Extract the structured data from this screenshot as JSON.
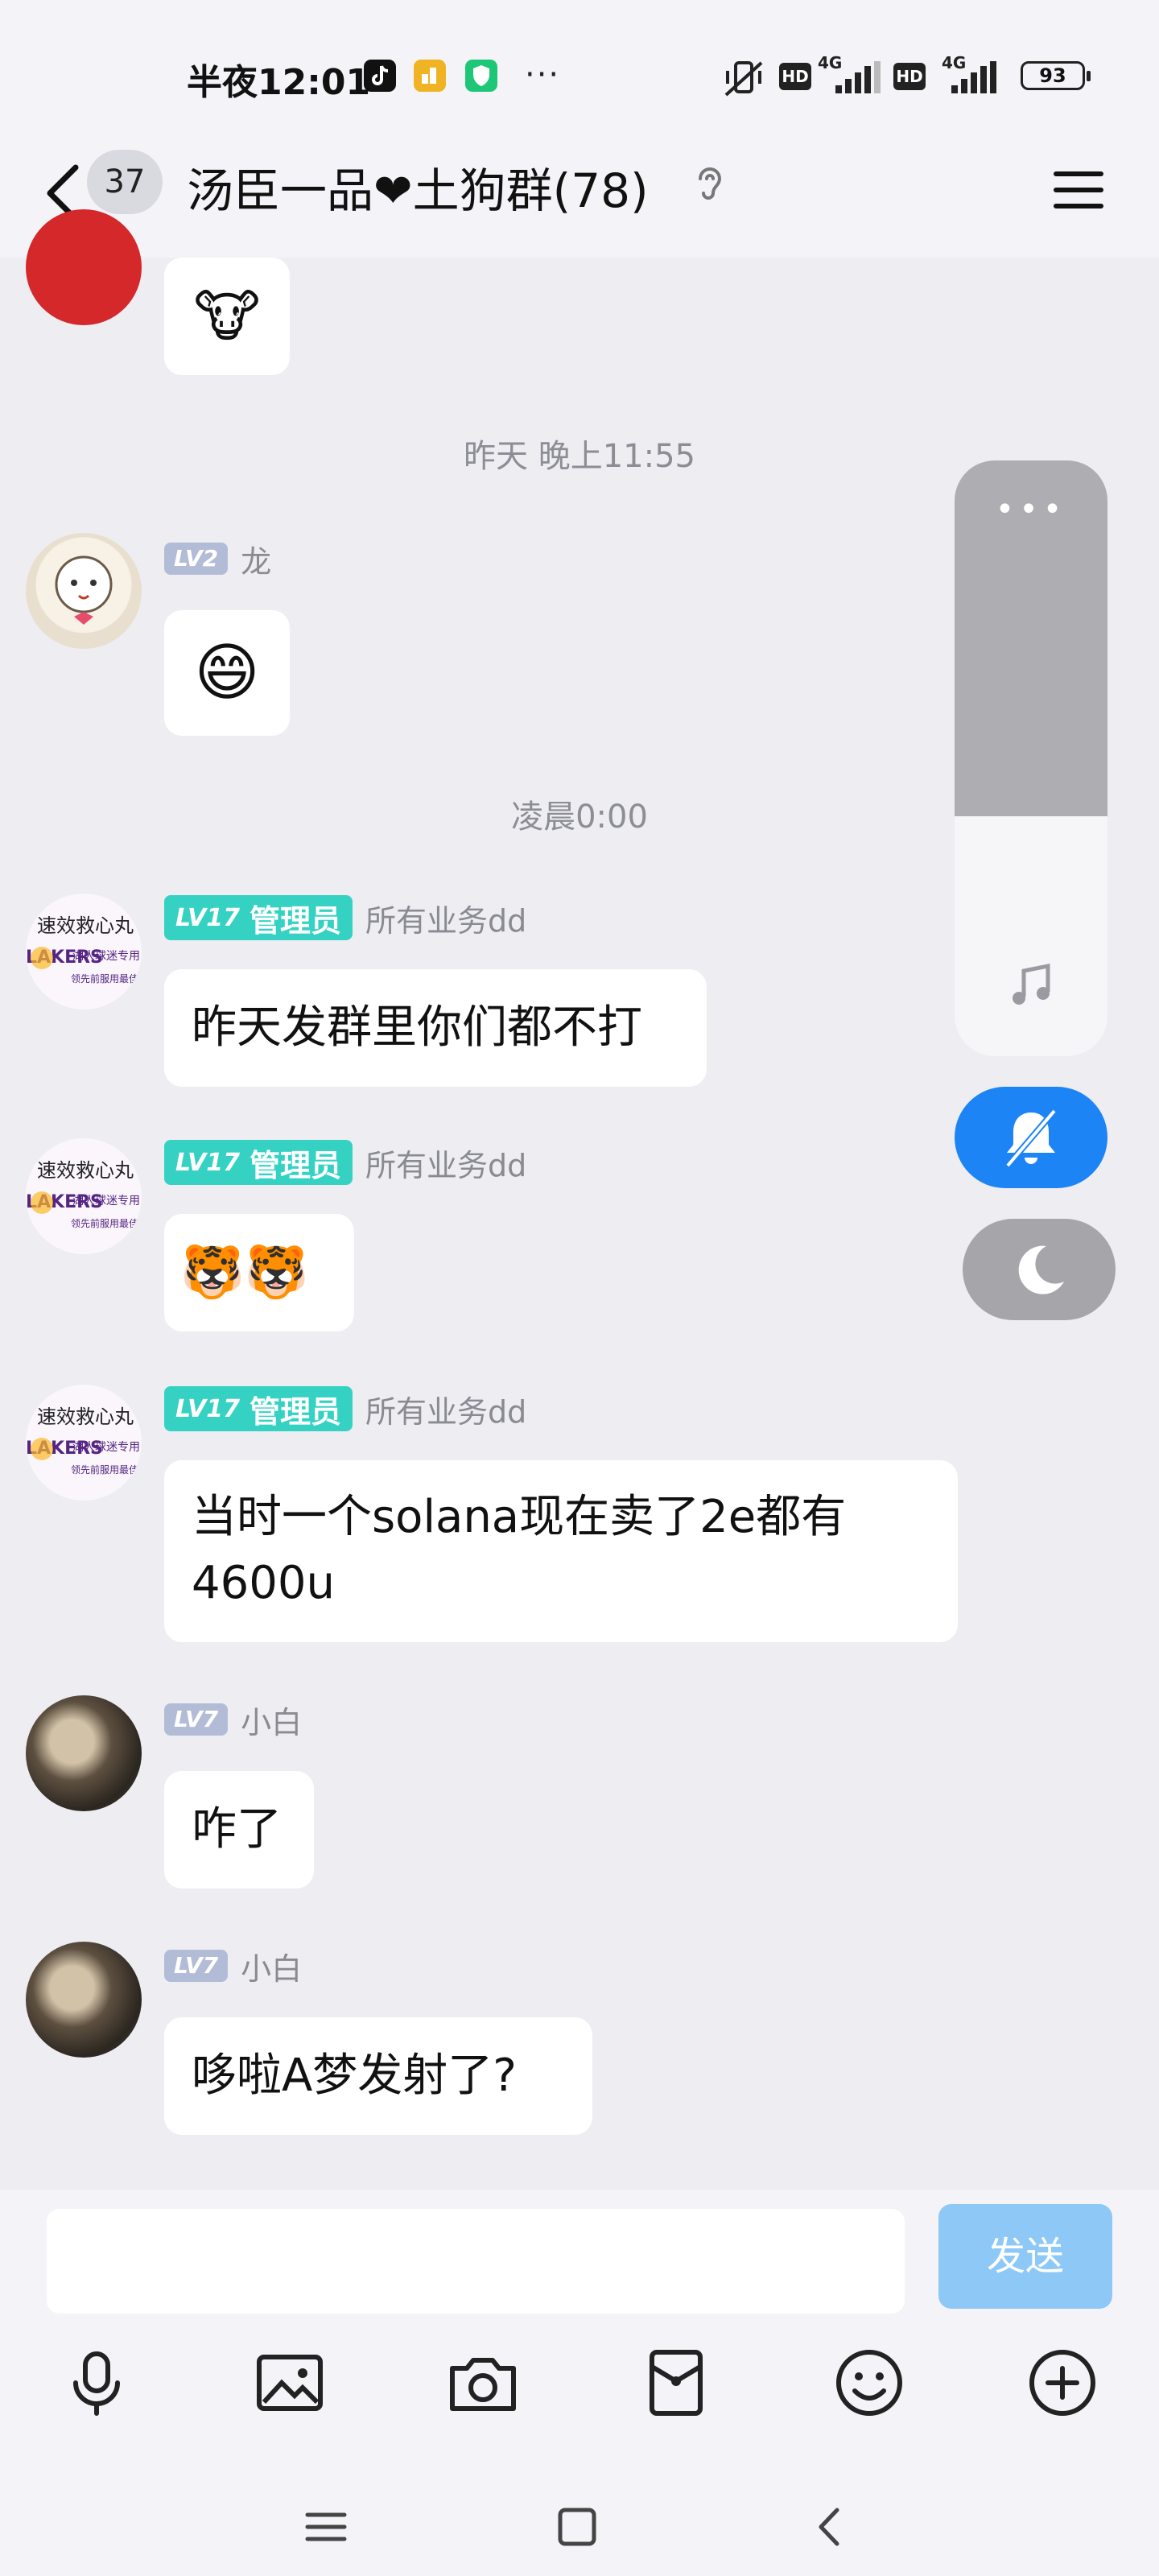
{
  "status_bar": {
    "time": "半夜12:01",
    "network_1": "4G",
    "network_2": "4G",
    "hd_1": "HD",
    "hd_2": "HD",
    "battery": "93"
  },
  "header": {
    "unread_count": "37",
    "title": "汤臣一品❤土狗群(78)"
  },
  "chat": {
    "time_1": "昨天 晚上11:55",
    "time_2": "凌晨0:00",
    "messages": [
      {
        "level": "LV2",
        "name": "龙",
        "text": "😄"
      },
      {
        "level": "LV17",
        "role": "管理员",
        "name": "所有业务dd",
        "text": "昨天发群里你们都不打"
      },
      {
        "level": "LV17",
        "role": "管理员",
        "name": "所有业务dd",
        "text": "🐯🐯"
      },
      {
        "level": "LV17",
        "role": "管理员",
        "name": "所有业务dd",
        "text_line1": "当时一个solana现在卖了2e都有",
        "text_line2": "4600u"
      },
      {
        "level": "LV7",
        "name": "小白",
        "text": "咋了"
      },
      {
        "level": "LV7",
        "name": "小白",
        "text": "哆啦A梦发射了?"
      }
    ],
    "top_message_emoji": "🐮"
  },
  "input_bar": {
    "placeholder": "",
    "send_label": "发送"
  },
  "colors": {
    "accent_blue": "#1d84f5",
    "admin_teal": "#35d2c4",
    "send_disabled": "#8ec8f7"
  },
  "icons": [
    "back-icon",
    "ear-icon",
    "menu-icon",
    "music-note-icon",
    "bell-off-icon",
    "moon-icon",
    "microphone-icon",
    "image-icon",
    "camera-icon",
    "red-packet-icon",
    "emoji-icon",
    "plus-icon",
    "nav-menu-icon",
    "nav-home-icon",
    "nav-back-icon"
  ]
}
